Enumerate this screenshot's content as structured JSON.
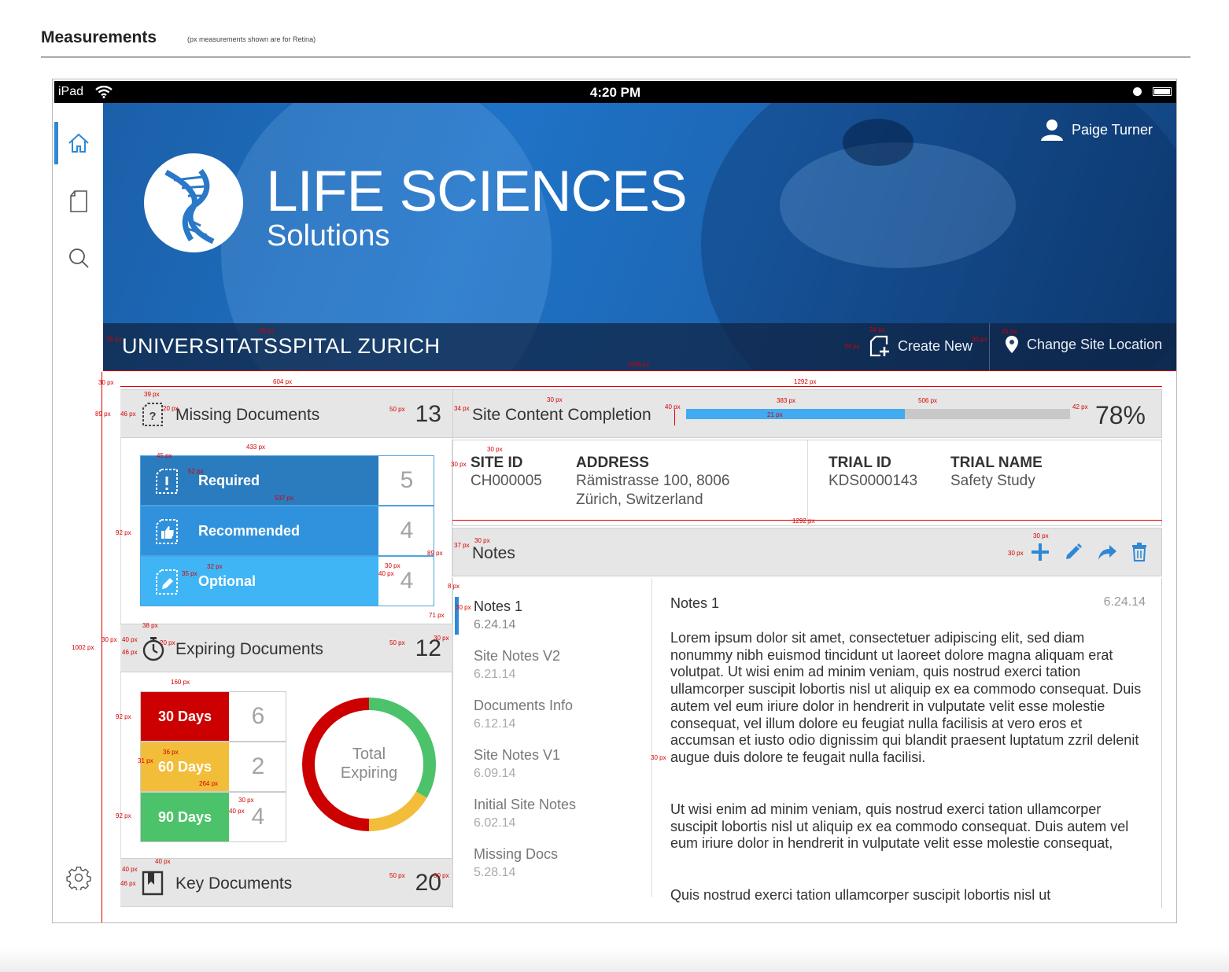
{
  "page": {
    "title": "Measurements",
    "note": "(px measurements shown are for Retina)"
  },
  "status_bar": {
    "carrier": "iPad",
    "time": "4:20 PM"
  },
  "hero": {
    "brand_line1": "LIFE SCIENCES",
    "brand_line2": "Solutions",
    "user_name": "Paige Turner",
    "site_name": "UNIVERSITATSSPITAL ZURICH",
    "create_new": "Create New",
    "change_location": "Change Site Location"
  },
  "missing_documents": {
    "label": "Missing Documents",
    "count": "13",
    "rows": [
      {
        "label": "Required",
        "value": "5",
        "color": "#2b7bbf"
      },
      {
        "label": "Recommended",
        "value": "4",
        "color": "#3092dc"
      },
      {
        "label": "Optional",
        "value": "4",
        "color": "#40b5f5"
      }
    ]
  },
  "expiring_documents": {
    "label": "Expiring Documents",
    "count": "12",
    "rows": [
      {
        "label": "30 Days",
        "value": "6",
        "color": "#cc0000"
      },
      {
        "label": "60 Days",
        "value": "2",
        "color": "#f2bd38"
      },
      {
        "label": "90 Days",
        "value": "4",
        "color": "#4cc26b"
      }
    ],
    "donut_label_1": "Total",
    "donut_label_2": "Expiring"
  },
  "key_documents": {
    "label": "Key Documents",
    "count": "20"
  },
  "completion": {
    "title": "Site Content Completion",
    "percent_text": "78%",
    "progress": 0.57
  },
  "site_info": {
    "site_id_label": "SITE ID",
    "site_id": "CH000005",
    "address_label": "ADDRESS",
    "address_line1": "Rämistrasse 100, 8006",
    "address_line2": "Zürich, Switzerland",
    "trial_id_label": "TRIAL ID",
    "trial_id": "KDS0000143",
    "trial_name_label": "TRIAL NAME",
    "trial_name": "Safety Study"
  },
  "notes": {
    "title": "Notes",
    "list": [
      {
        "title": "Notes 1",
        "date": "6.24.14"
      },
      {
        "title": "Site Notes V2",
        "date": "6.21.14"
      },
      {
        "title": "Documents Info",
        "date": "6.12.14"
      },
      {
        "title": "Site Notes V1",
        "date": "6.09.14"
      },
      {
        "title": "Initial Site Notes",
        "date": "6.02.14"
      },
      {
        "title": "Missing Docs",
        "date": "5.28.14"
      }
    ],
    "active": {
      "title": "Notes 1",
      "date": "6.24.14",
      "p1": "Lorem ipsum dolor sit amet, consectetuer adipiscing elit, sed diam nonummy nibh euismod tincidunt ut laoreet dolore magna aliquam erat volutpat. Ut wisi enim ad minim veniam, quis nostrud exerci tation ullamcorper suscipit lobortis nisl ut aliquip ex ea commodo consequat. Duis autem vel eum iriure dolor in hendrerit in vulputate velit esse molestie consequat, vel illum dolore eu feugiat nulla facilisis at vero eros et accumsan et iusto odio dignissim qui blandit praesent luptatum zzril delenit augue duis dolore te feugait nulla facilisi.",
      "p2": "Ut wisi enim ad minim veniam, quis nostrud exerci tation ullamcorper suscipit lobortis nisl ut aliquip ex ea commodo consequat. Duis autem vel eum iriure dolor in hendrerit in vulputate velit esse molestie consequat,",
      "p3": "Quis nostrud exerci tation ullamcorper suscipit lobortis nisl ut"
    }
  },
  "measurements": {
    "m28": "28 px",
    "m35": "35 px",
    "m1936": "1936 px",
    "m34": "34 px",
    "m30": "30 px",
    "m21": "21 px",
    "m604": "604 px",
    "m1292": "1292 px",
    "m89": "89 px",
    "m46": "46 px",
    "m39": "39 px",
    "m20": "20 px",
    "m50": "50 px",
    "m40": "40 px",
    "m383": "383 px",
    "m506": "506 px",
    "m42": "42 px",
    "m433": "433 px",
    "m45": "45 px",
    "m52": "52 px",
    "m537": "537 px",
    "m92": "92 px",
    "m37": "37 px",
    "m32": "32 px",
    "m8": "8 px",
    "m71": "71 px",
    "m1002": "1002 px",
    "m38": "38 px",
    "m160": "160 px",
    "m36": "36 px",
    "m31": "31 px",
    "m264": "264 px"
  }
}
